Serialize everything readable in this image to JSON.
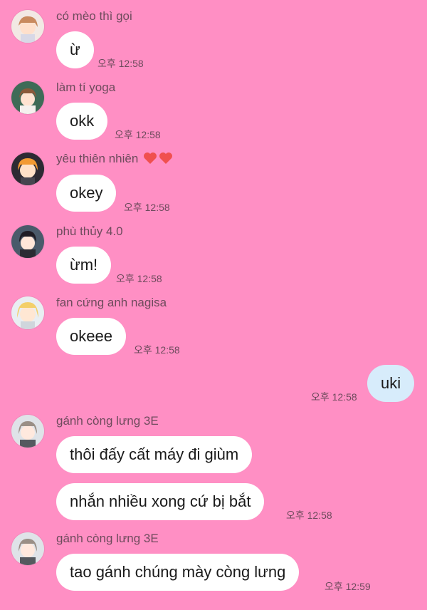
{
  "messages": [
    {
      "sender": "có mèo thì gọi",
      "text": "ừ",
      "time": "오후 12:58"
    },
    {
      "sender": "làm tí yoga",
      "text": "okk",
      "time": "오후 12:58"
    },
    {
      "sender": "yêu thiên nhiên",
      "text": "okey",
      "time": "오후 12:58"
    },
    {
      "sender": "phù thủy 4.0",
      "text": "ừm!",
      "time": "오후 12:58"
    },
    {
      "sender": "fan cứng anh nagisa",
      "text": "okeee",
      "time": "오후 12:58"
    },
    {
      "sender": "",
      "text": "uki",
      "time": "오후 12:58"
    },
    {
      "sender": "gánh còng lưng 3E",
      "text": "thôi đấy cất máy đi giùm",
      "time": ""
    },
    {
      "sender": "",
      "text": "nhắn nhiều xong cứ bị bắt",
      "time": "오후 12:58"
    },
    {
      "sender": "gánh còng lưng 3E",
      "text": "tao gánh chúng mày còng lưng",
      "time": "오후 12:59"
    }
  ],
  "icons": {
    "heart": "heart-icon"
  },
  "colors": {
    "background": "#ff8fc4",
    "incoming_bubble": "#ffffff",
    "outgoing_bubble": "#d7ecfb",
    "meta_text": "#6e4b5c",
    "heart": "#f0504f"
  }
}
